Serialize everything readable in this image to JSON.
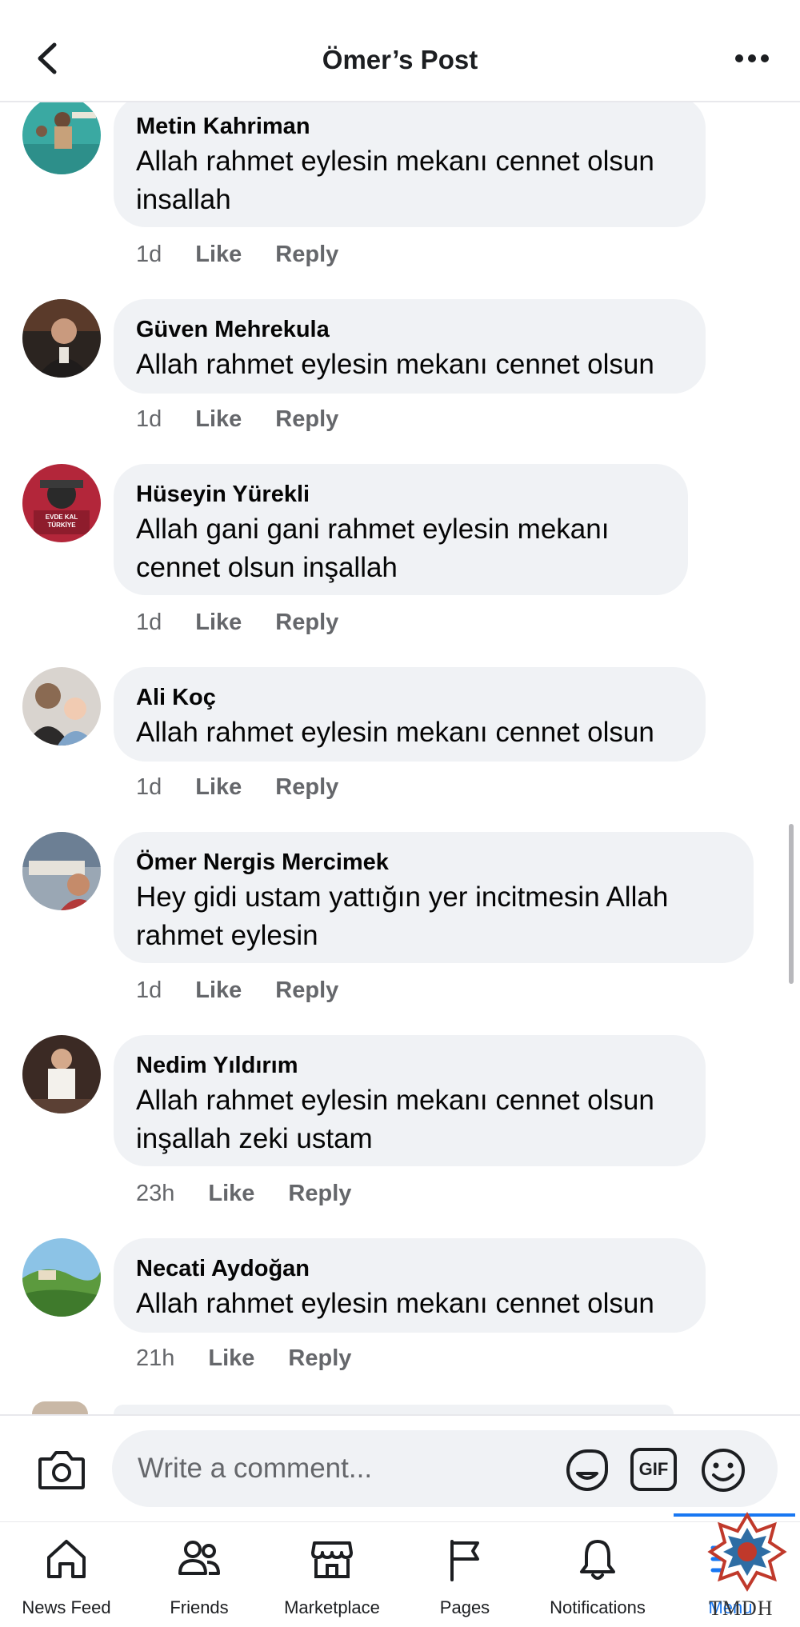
{
  "header": {
    "title": "Ömer’s Post"
  },
  "comments": [
    {
      "name": "Metin Kahriman",
      "text": [
        "Allah rahmet eylesin mekanı cennet olsun",
        "insallah"
      ],
      "time": "1d",
      "like": "Like",
      "reply": "Reply"
    },
    {
      "name": "Güven Mehrekula",
      "text": [
        "Allah rahmet eylesin mekanı cennet olsun"
      ],
      "time": "1d",
      "like": "Like",
      "reply": "Reply"
    },
    {
      "name": "Hüseyin Yürekli",
      "text": [
        "Allah gani gani rahmet eylesin mekanı",
        "cennet olsun inşallah"
      ],
      "time": "1d",
      "like": "Like",
      "reply": "Reply",
      "avatar_badge": [
        "EVDE KAL",
        "TÜRKİYE"
      ]
    },
    {
      "name": "Ali Koç",
      "text": [
        "Allah rahmet eylesin mekanı cennet olsun"
      ],
      "time": "1d",
      "like": "Like",
      "reply": "Reply"
    },
    {
      "name": "Ömer Nergis Mercimek",
      "text": [
        "Hey gidi ustam yattığın yer incitmesin Allah",
        "rahmet eylesin"
      ],
      "time": "1d",
      "like": "Like",
      "reply": "Reply"
    },
    {
      "name": "Nedim Yıldırım",
      "text": [
        "Allah rahmet eylesin mekanı cennet olsun",
        "inşallah zeki ustam"
      ],
      "time": "23h",
      "like": "Like",
      "reply": "Reply"
    },
    {
      "name": "Necati Aydoğan",
      "text": [
        "Allah rahmet eylesin mekanı cennet olsun"
      ],
      "time": "21h",
      "like": "Like",
      "reply": "Reply"
    }
  ],
  "composer": {
    "placeholder": "Write a comment...",
    "gif_label": "GIF"
  },
  "nav": {
    "items": [
      {
        "label": "News Feed",
        "icon": "home-icon"
      },
      {
        "label": "Friends",
        "icon": "friends-icon"
      },
      {
        "label": "Marketplace",
        "icon": "marketplace-icon"
      },
      {
        "label": "Pages",
        "icon": "flag-icon"
      },
      {
        "label": "Notifications",
        "icon": "bell-icon"
      },
      {
        "label": "Menu",
        "icon": "menu-icon",
        "active": true
      }
    ]
  },
  "watermark": {
    "text": "TMDH"
  },
  "colors": {
    "bubble": "#f0f2f5",
    "meta_text": "#65676b",
    "accent": "#1877f2"
  }
}
